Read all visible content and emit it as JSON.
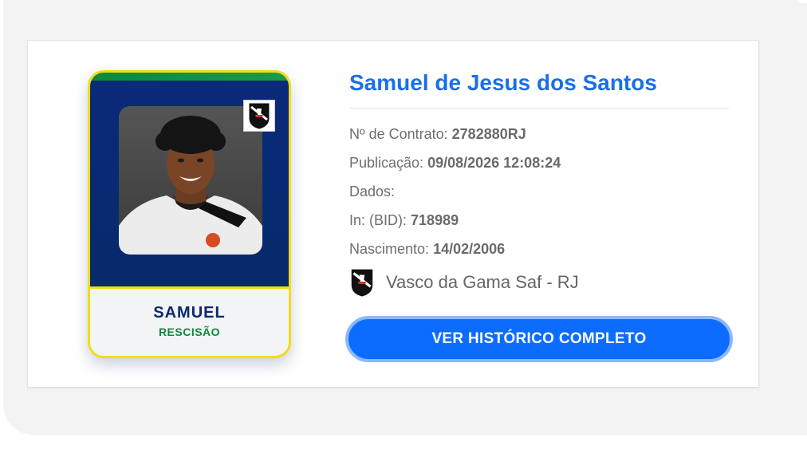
{
  "player": {
    "full_name": "Samuel de Jesus dos Santos",
    "card_name": "SAMUEL",
    "status": "RESCISÃO"
  },
  "details": {
    "contract_label": "Nº de Contrato:",
    "contract_value": "2782880RJ",
    "publication_label": "Publicação:",
    "publication_value": "09/08/2026 12:08:24",
    "data_label": "Dados:",
    "bid_label": "In: (BID):",
    "bid_value": "718989",
    "birth_label": "Nascimento:",
    "birth_value": "14/02/2006"
  },
  "club": {
    "name": "Vasco da Gama Saf - RJ",
    "crest_icon": "vasco-crest-icon"
  },
  "actions": {
    "history_button": "VER HISTÓRICO COMPLETO"
  },
  "colors": {
    "accent_blue": "#1a6fe8",
    "button_blue": "#0b6cff",
    "card_navy": "#0b2a7a",
    "card_border_yellow": "#f2dc16",
    "status_green": "#0a8a3a"
  }
}
